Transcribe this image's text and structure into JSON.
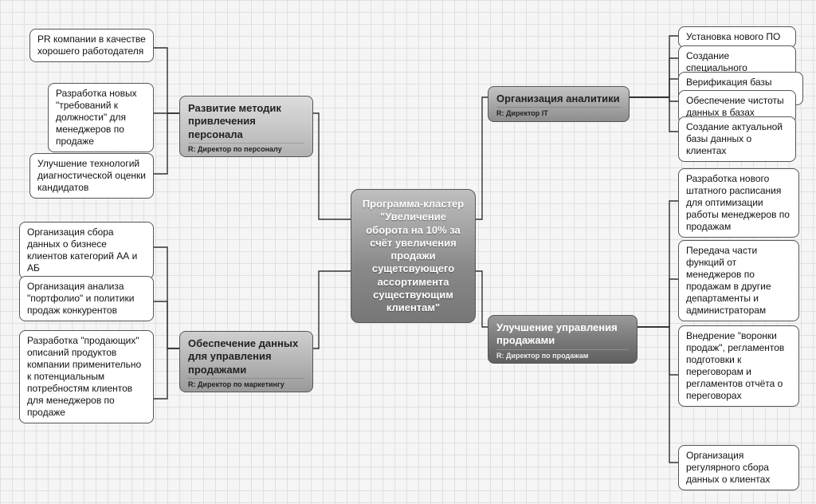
{
  "center": {
    "title": "Программа-кластер \"Увеличение оборота на 10% за счёт увеличения продажи сущетсвующего ассортимента существующим клиентам\""
  },
  "branches": {
    "personnel": {
      "title": "Развитие методик привлечения персонала",
      "responsible": "R: Директор по персоналу",
      "leaves": [
        "PR компании в качестве хорошего работодателя",
        "Разработка новых \"требований к должности\" для менеджеров по продаже",
        "Улучшение технологий диагностической оценки кандидатов"
      ]
    },
    "marketing": {
      "title": "Обеспечение данных для управления продажами",
      "responsible": "R: Директор по маркетингу",
      "leaves": [
        "Организация сбора данных о бизнесе клиентов категорий АА и АБ",
        "Организация анализа \"портфолио\" и политики продаж конкурентов",
        "Разработка \"продающих\" описаний продуктов компании применительно к потенциальным потребностям клиентов для менеджеров по продаже"
      ]
    },
    "analytics": {
      "title": "Организация аналитики",
      "responsible": "R: Директор IT",
      "leaves": [
        "Установка нового ПО",
        "Создание специального подразделения",
        "Верификация базы данных",
        "Обеспечение чистоты данных в базах",
        "Создание актуальной базы данных о клиентах"
      ]
    },
    "sales": {
      "title": "Улучшение управления продажами",
      "responsible": "R: Директор по продажам",
      "leaves": [
        "Разработка нового штатного расписания для оптимизации работы менеджеров по продажам",
        "Передача части функций от менеджеров по продажам в другие департаменты и администраторам",
        "Внедрение \"воронки продаж\", регламентов подготовки к переговорам и регламентов отчёта о переговорах",
        "Организация регулярного сбора данных о клиентах"
      ]
    }
  }
}
